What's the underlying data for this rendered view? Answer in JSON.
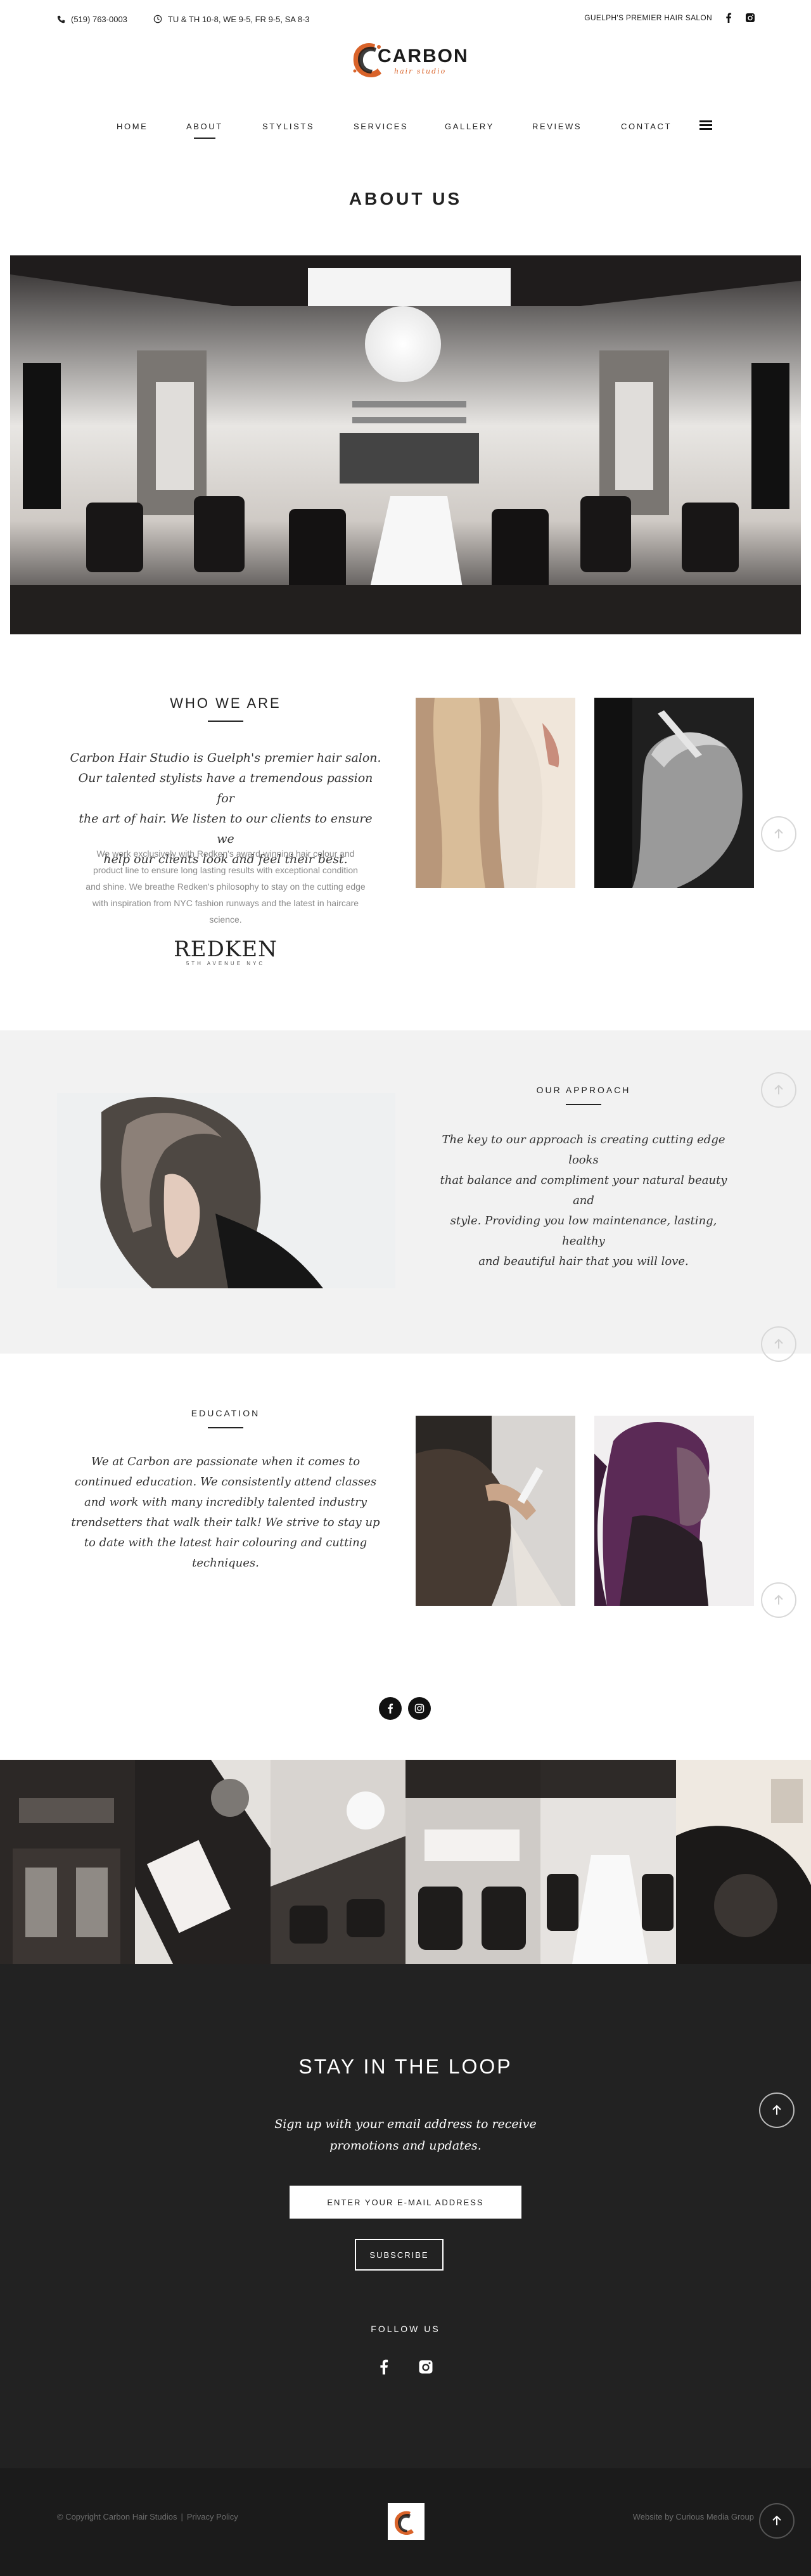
{
  "topbar": {
    "phone": "(519) 763-0003",
    "hours": "TU & TH 10-8, WE 9-5, FR 9-5, SA 8-3",
    "tagline": "GUELPH'S PREMIER HAIR SALON"
  },
  "logo": {
    "name": "CARBON",
    "sub": "hair studio"
  },
  "nav": {
    "items": [
      "HOME",
      "ABOUT",
      "STYLISTS",
      "SERVICES",
      "GALLERY",
      "REVIEWS",
      "CONTACT"
    ],
    "active": "ABOUT"
  },
  "page_title": "ABOUT US",
  "who": {
    "heading": "WHO WE ARE",
    "lead_lines": [
      "Carbon Hair Studio is Guelph's premier hair salon.",
      "Our talented stylists have a tremendous passion for",
      "the art of hair. We listen to our clients to ensure we",
      "help our clients look and feel their best."
    ],
    "para_lines": [
      "We work exclusively with Redken's award-winning hair colour and",
      "product line to ensure long lasting results with exceptional condition",
      "and shine. We breathe Redken's philosophy to stay on the cutting edge",
      "with inspiration from NYC fashion runways and the latest in haircare",
      "science."
    ],
    "brand": "REDKEN",
    "brand_sub": "5TH AVENUE NYC"
  },
  "approach": {
    "heading": "OUR APPROACH",
    "lead_lines": [
      "The key to our approach is creating cutting edge looks",
      "that balance and compliment your natural beauty and",
      "style. Providing you low maintenance, lasting, healthy",
      "and beautiful hair that you will love."
    ]
  },
  "education": {
    "heading": "EDUCATION",
    "lead_lines": [
      "We at Carbon are passionate when it comes to",
      "continued education.  We consistently attend classes",
      "and work with many incredibly talented industry",
      "trendsetters that walk their talk!  We strive to stay up",
      "to date with the latest hair colouring and cutting",
      "techniques."
    ]
  },
  "newsletter": {
    "heading": "STAY IN THE LOOP",
    "lead_lines": [
      "Sign up with your email address to receive",
      "promotions and updates."
    ],
    "email_placeholder": "ENTER YOUR E-MAIL ADDRESS",
    "subscribe": "SUBSCRIBE",
    "follow": "FOLLOW US"
  },
  "footer": {
    "copyright": "© Copyright Carbon Hair Studios",
    "privacy": "Privacy Policy",
    "divider": "|",
    "credit": "Website by Curious Media Group"
  },
  "colors": {
    "accent": "#d9632a",
    "dark": "#222222",
    "band": "#f2f2f2"
  }
}
